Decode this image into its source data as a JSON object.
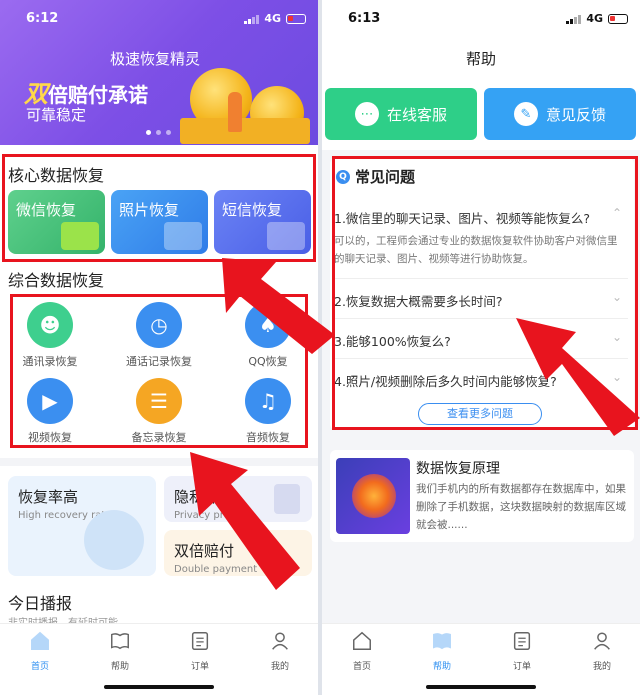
{
  "colors": {
    "accent": "#2e8ff0",
    "annotation_red": "#e8141e",
    "banner_purple": "#7d4fe6",
    "wechat_green": "#4cc27a",
    "photo_blue": "#3b8ff0",
    "sms_blue": "#5a74f0",
    "kefu_green": "#2ecf88",
    "feedback_blue": "#35a2f4"
  },
  "left": {
    "status": {
      "time": "6:12",
      "network": "4G"
    },
    "banner": {
      "app_name": "极速恢复精灵",
      "slogan_em": "双",
      "slogan_rest": "倍赔付承诺",
      "sub": "可靠稳定"
    },
    "core": {
      "title": "核心数据恢复",
      "cards": [
        {
          "label": "微信恢复",
          "icon": "wechat-icon"
        },
        {
          "label": "照片恢复",
          "icon": "photo-icon"
        },
        {
          "label": "短信恢复",
          "icon": "sms-icon"
        }
      ]
    },
    "general": {
      "title": "综合数据恢复",
      "items": [
        {
          "label": "通讯录恢复",
          "icon": "contacts-icon",
          "color": "#3ecf8e"
        },
        {
          "label": "通话记录恢复",
          "icon": "call-log-icon",
          "color": "#3b8ff0"
        },
        {
          "label": "QQ恢复",
          "icon": "qq-icon",
          "color": "#3b8ff0"
        },
        {
          "label": "视频恢复",
          "icon": "video-icon",
          "color": "#3b8ff0"
        },
        {
          "label": "备忘录恢复",
          "icon": "memo-icon",
          "color": "#f5a623"
        },
        {
          "label": "音频恢复",
          "icon": "audio-icon",
          "color": "#3b8ff0"
        }
      ]
    },
    "features": {
      "rate": {
        "title": "恢复率高",
        "sub": "High recovery rate"
      },
      "privacy": {
        "title": "隐私保护",
        "sub": "Privacy protect"
      },
      "double": {
        "title": "双倍赔付",
        "sub": "Double payment"
      }
    },
    "news": {
      "title": "今日播报",
      "sub": "非实时播报，有延时可能"
    },
    "tabs": [
      {
        "label": "首页",
        "icon": "home-icon",
        "active": true
      },
      {
        "label": "帮助",
        "icon": "book-icon"
      },
      {
        "label": "订单",
        "icon": "order-icon"
      },
      {
        "label": "我的",
        "icon": "user-icon"
      }
    ]
  },
  "right": {
    "status": {
      "time": "6:13",
      "network": "4G"
    },
    "title": "帮助",
    "buttons": {
      "service": "在线客服",
      "feedback": "意见反馈"
    },
    "faq": {
      "title": "常见问题",
      "items": [
        {
          "q": "1.微信里的聊天记录、图片、视频等能恢复么?",
          "a": "可以的，工程师会通过专业的数据恢复软件协助客户对微信里的聊天记录、图片、视频等进行协助恢复。",
          "expanded": true
        },
        {
          "q": "2.恢复数据大概需要多长时间?"
        },
        {
          "q": "3.能够100%恢复么?"
        },
        {
          "q": "4.照片/视频删除后多久时间内能够恢复?"
        }
      ],
      "more": "查看更多问题"
    },
    "principle": {
      "title": "数据恢复原理",
      "desc": "我们手机内的所有数据都存在数据库中，如果删除了手机数据，这块数据映射的数据库区域就会被......"
    },
    "tabs": [
      {
        "label": "首页",
        "icon": "home-icon"
      },
      {
        "label": "帮助",
        "icon": "book-icon",
        "active": true
      },
      {
        "label": "订单",
        "icon": "order-icon"
      },
      {
        "label": "我的",
        "icon": "user-icon"
      }
    ]
  }
}
